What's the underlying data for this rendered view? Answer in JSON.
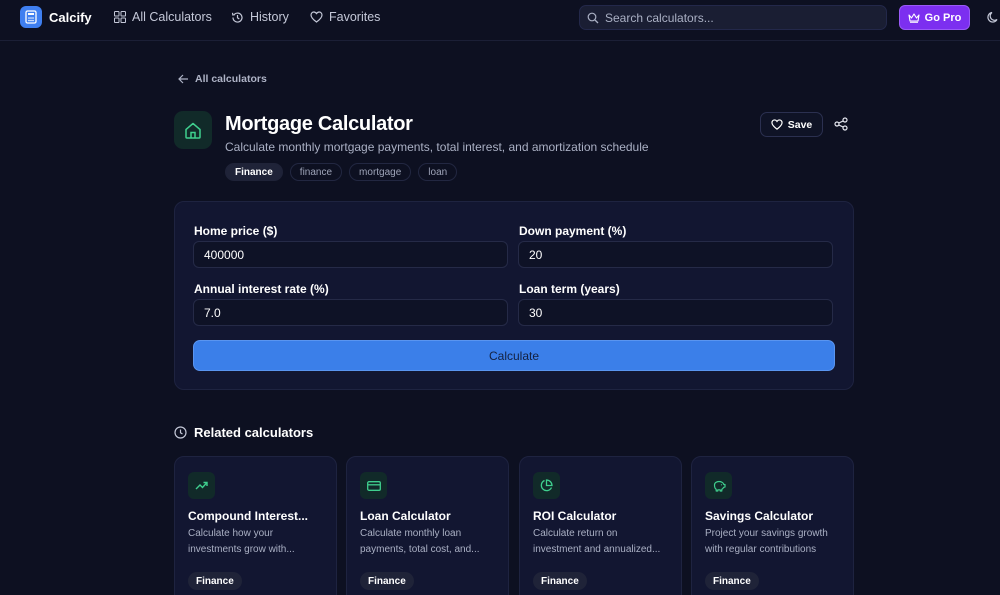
{
  "app": {
    "name": "Calcify",
    "nav": [
      {
        "label": "All Calculators",
        "icon": "grid-icon"
      },
      {
        "label": "History",
        "icon": "history-icon"
      },
      {
        "label": "Favorites",
        "icon": "heart-icon"
      }
    ],
    "search_placeholder": "Search calculators...",
    "go_pro_label": "Go Pro",
    "accent_color": "#3b7fe9",
    "pro_color": "#7c2ff0"
  },
  "back_link": "All calculators",
  "calculator": {
    "title": "Mortgage Calculator",
    "subtitle": "Calculate monthly mortgage payments, total interest, and amortization schedule",
    "icon": "home-icon",
    "tags": [
      "Finance",
      "finance",
      "mortgage",
      "loan"
    ],
    "save_label": "Save"
  },
  "form": {
    "fields": [
      {
        "label": "Home price ($)",
        "value": "400000"
      },
      {
        "label": "Down payment (%)",
        "value": "20"
      },
      {
        "label": "Annual interest rate (%)",
        "value": "7.0"
      },
      {
        "label": "Loan term (years)",
        "value": "30"
      }
    ],
    "submit_label": "Calculate"
  },
  "related": {
    "heading": "Related calculators",
    "items": [
      {
        "title": "Compound Interest...",
        "description": "Calculate how your investments grow with...",
        "tag": "Finance",
        "icon": "trending-up-icon"
      },
      {
        "title": "Loan Calculator",
        "description": "Calculate monthly loan payments, total cost, and...",
        "tag": "Finance",
        "icon": "credit-card-icon"
      },
      {
        "title": "ROI Calculator",
        "description": "Calculate return on investment and annualized...",
        "tag": "Finance",
        "icon": "pie-chart-icon"
      },
      {
        "title": "Savings Calculator",
        "description": "Project your savings growth with regular contributions",
        "tag": "Finance",
        "icon": "piggy-bank-icon"
      }
    ]
  }
}
